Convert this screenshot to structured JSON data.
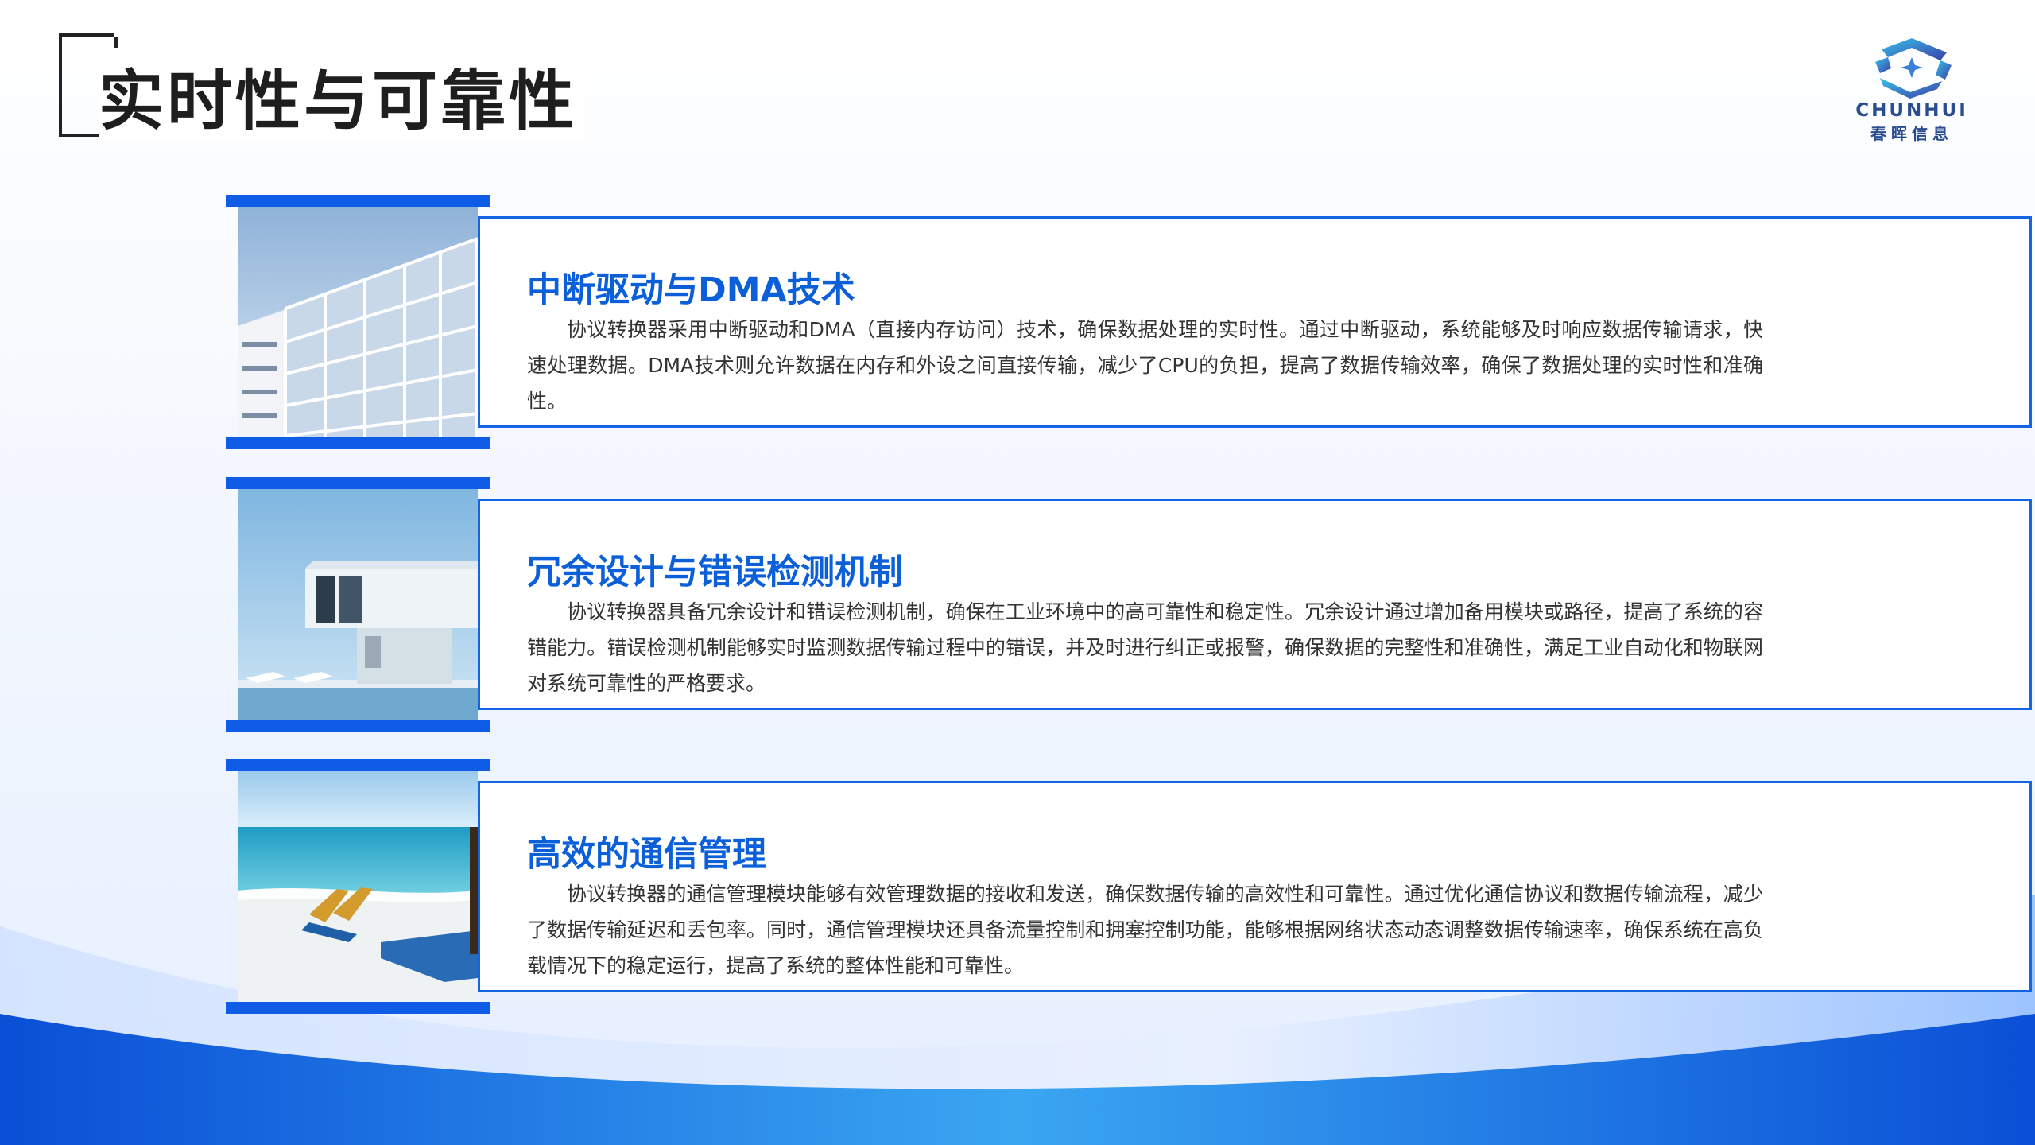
{
  "page": {
    "title": "实时性与可靠性"
  },
  "logo": {
    "en": "CHUNHUI",
    "cn": "春晖信息",
    "icon": "chunhui-logo-icon",
    "accent": "#2a4d8f"
  },
  "colors": {
    "accent_blue": "#0f5ce6",
    "heading_blue": "#0b5fd8",
    "border_blue": "#1464e6",
    "body_text": "#333333"
  },
  "cards": [
    {
      "heading": "中断驱动与DMA技术",
      "text": "协议转换器采用中断驱动和DMA（直接内存访问）技术，确保数据处理的实时性。通过中断驱动，系统能够及时响应数据传输请求，快速处理数据。DMA技术则允许数据在内存和外设之间直接传输，减少了CPU的负担，提高了数据传输效率，确保了数据处理的实时性和准确性。",
      "image": "glass-building-photo"
    },
    {
      "heading": "冗余设计与错误检测机制",
      "text": "协议转换器具备冗余设计和错误检测机制，确保在工业环境中的高可靠性和稳定性。冗余设计通过增加备用模块或路径，提高了系统的容错能力。错误检测机制能够实时监测数据传输过程中的错误，并及时进行纠正或报警，确保数据的完整性和准确性，满足工业自动化和物联网对系统可靠性的严格要求。",
      "image": "modern-villa-photo"
    },
    {
      "heading": "高效的通信管理",
      "text": "协议转换器的通信管理模块能够有效管理数据的接收和发送，确保数据传输的高效性和可靠性。通过优化通信协议和数据传输流程，减少了数据传输延迟和丢包率。同时，通信管理模块还具备流量控制和拥塞控制功能，能够根据网络状态动态调整数据传输速率，确保系统在高负载情况下的稳定运行，提高了系统的整体性能和可靠性。",
      "image": "beach-loungers-photo"
    }
  ]
}
